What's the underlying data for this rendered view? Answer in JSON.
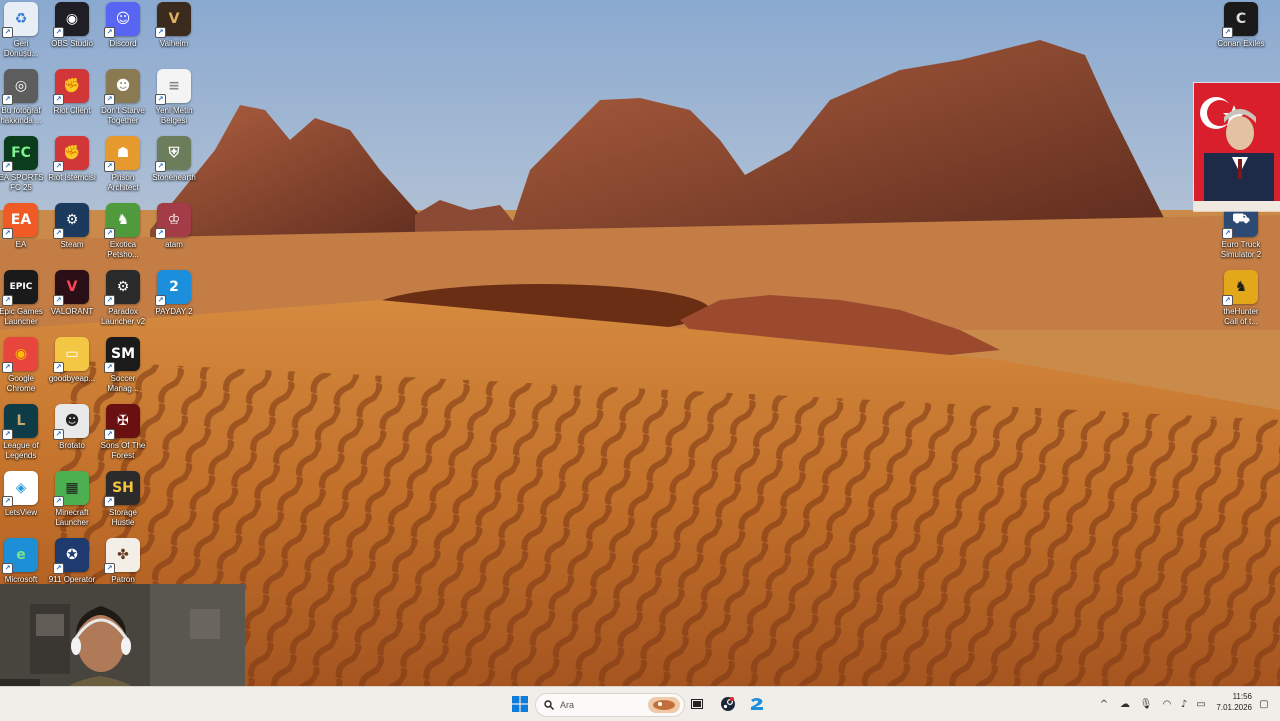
{
  "desktop": {
    "left_icons": [
      {
        "label": "Geri\nDönüşü...",
        "glyph": "♻",
        "color": "#e8eef6",
        "fg": "#3a7bd5",
        "col": 0,
        "row": 0
      },
      {
        "label": "OBS Studio",
        "glyph": "◉",
        "color": "#1e1e24",
        "fg": "#fff",
        "col": 1,
        "row": 0
      },
      {
        "label": "Discord",
        "glyph": "☺",
        "color": "#5865f2",
        "fg": "#fff",
        "col": 2,
        "row": 0
      },
      {
        "label": "Valheim",
        "glyph": "V",
        "color": "#3b2a1e",
        "fg": "#e0b060",
        "col": 3,
        "row": 0
      },
      {
        "label": "Bu fotoğraf\nhakkında ...",
        "glyph": "◎",
        "color": "#5d5d5d",
        "fg": "#fff",
        "col": 0,
        "row": 1
      },
      {
        "label": "Riot Client",
        "glyph": "✊",
        "color": "#d13639",
        "fg": "#fff",
        "col": 1,
        "row": 1
      },
      {
        "label": "Don't Starve\nTogether",
        "glyph": "☻",
        "color": "#8a7a52",
        "fg": "#fff",
        "col": 2,
        "row": 1
      },
      {
        "label": "Yeni Metin\nBelgesi",
        "glyph": "≡",
        "color": "#f4f4f4",
        "fg": "#888",
        "col": 3,
        "row": 1
      },
      {
        "label": "EA SPORTS\nFC 25",
        "glyph": "FC",
        "color": "#0b3d1c",
        "fg": "#7ef08c",
        "col": 0,
        "row": 2
      },
      {
        "label": "Riot İstemcisi",
        "glyph": "✊",
        "color": "#d13639",
        "fg": "#fff",
        "col": 1,
        "row": 2
      },
      {
        "label": "Prison\nArchitect",
        "glyph": "☗",
        "color": "#e69a2e",
        "fg": "#fff",
        "col": 2,
        "row": 2
      },
      {
        "label": "Stonehearth",
        "glyph": "⛨",
        "color": "#6b7d5a",
        "fg": "#fff",
        "col": 3,
        "row": 2
      },
      {
        "label": "EA",
        "glyph": "EA",
        "color": "#f05a24",
        "fg": "#fff",
        "col": 0,
        "row": 3
      },
      {
        "label": "Steam",
        "glyph": "⚙",
        "color": "#1b3a5e",
        "fg": "#fff",
        "col": 1,
        "row": 3
      },
      {
        "label": "Exotica\nPetsho...",
        "glyph": "♞",
        "color": "#4e9a3c",
        "fg": "#fff",
        "col": 2,
        "row": 3
      },
      {
        "label": "atam",
        "glyph": "♔",
        "color": "#a33c46",
        "fg": "#fff",
        "col": 3,
        "row": 3
      },
      {
        "label": "Epic Games\nLauncher",
        "glyph": "EPIC",
        "color": "#1a1a1a",
        "fg": "#fff",
        "col": 0,
        "row": 4
      },
      {
        "label": "VALORANT",
        "glyph": "V",
        "color": "#2a0f17",
        "fg": "#ff4655",
        "col": 1,
        "row": 4
      },
      {
        "label": "Paradox\nLauncher v2",
        "glyph": "⚙",
        "color": "#2a2a2a",
        "fg": "#fff",
        "col": 2,
        "row": 4
      },
      {
        "label": "PAYDAY 2",
        "glyph": "2",
        "color": "#1b8fdc",
        "fg": "#fff",
        "col": 3,
        "row": 4
      },
      {
        "label": "Google\nChrome",
        "glyph": "◉",
        "color": "#e8453c",
        "fg": "#fbbc05",
        "col": 0,
        "row": 5
      },
      {
        "label": "goodbyeap...",
        "glyph": "▭",
        "color": "#f3c743",
        "fg": "#fff",
        "col": 1,
        "row": 5
      },
      {
        "label": "Soccer\nManag...",
        "glyph": "SM",
        "color": "#1b1b1b",
        "fg": "#fff",
        "col": 2,
        "row": 5
      },
      {
        "label": "League of\nLegends",
        "glyph": "L",
        "color": "#0d3b46",
        "fg": "#c9aa6c",
        "col": 0,
        "row": 6
      },
      {
        "label": "Brotato",
        "glyph": "☻",
        "color": "#e8e8e8",
        "fg": "#222",
        "col": 1,
        "row": 6
      },
      {
        "label": "Sons Of The\nForest",
        "glyph": "✠",
        "color": "#6a1010",
        "fg": "#fff",
        "col": 2,
        "row": 6
      },
      {
        "label": "LetsView",
        "glyph": "◈",
        "color": "#ffffff",
        "fg": "#2a9bd8",
        "col": 0,
        "row": 7
      },
      {
        "label": "Minecraft\nLauncher",
        "glyph": "▦",
        "color": "#4caf50",
        "fg": "#1b1b1b",
        "col": 1,
        "row": 7
      },
      {
        "label": "Storage\nHustle",
        "glyph": "SH",
        "color": "#2b2b2b",
        "fg": "#f5c542",
        "col": 2,
        "row": 7
      },
      {
        "label": "Microsoft\nEdge",
        "glyph": "e",
        "color": "#1d8fd6",
        "fg": "#7be38d",
        "col": 0,
        "row": 8
      },
      {
        "label": "911 Operator",
        "glyph": "✪",
        "color": "#1e3a6e",
        "fg": "#fff",
        "col": 1,
        "row": 8
      },
      {
        "label": "Patron",
        "glyph": "✤",
        "color": "#f4efe6",
        "fg": "#6b3b2a",
        "col": 2,
        "row": 8
      }
    ],
    "right_icons": [
      {
        "label": "Conan Exiles",
        "glyph": "C",
        "color": "#1a1a1a",
        "fg": "#ddd",
        "row": 0
      },
      {
        "label": "Euro Truck\nSimulator 2",
        "glyph": "⛟",
        "color": "#2c4a74",
        "fg": "#fff",
        "row": 3
      },
      {
        "label": "theHunter\nCall of t...",
        "glyph": "♞",
        "color": "#e3a81a",
        "fg": "#1b1b1b",
        "row": 4
      }
    ]
  },
  "taskbar": {
    "search_placeholder": "Ara",
    "clock_time": "11:56",
    "clock_date": "7.01.2026",
    "colors": {
      "start": "#0f7bd8"
    }
  }
}
